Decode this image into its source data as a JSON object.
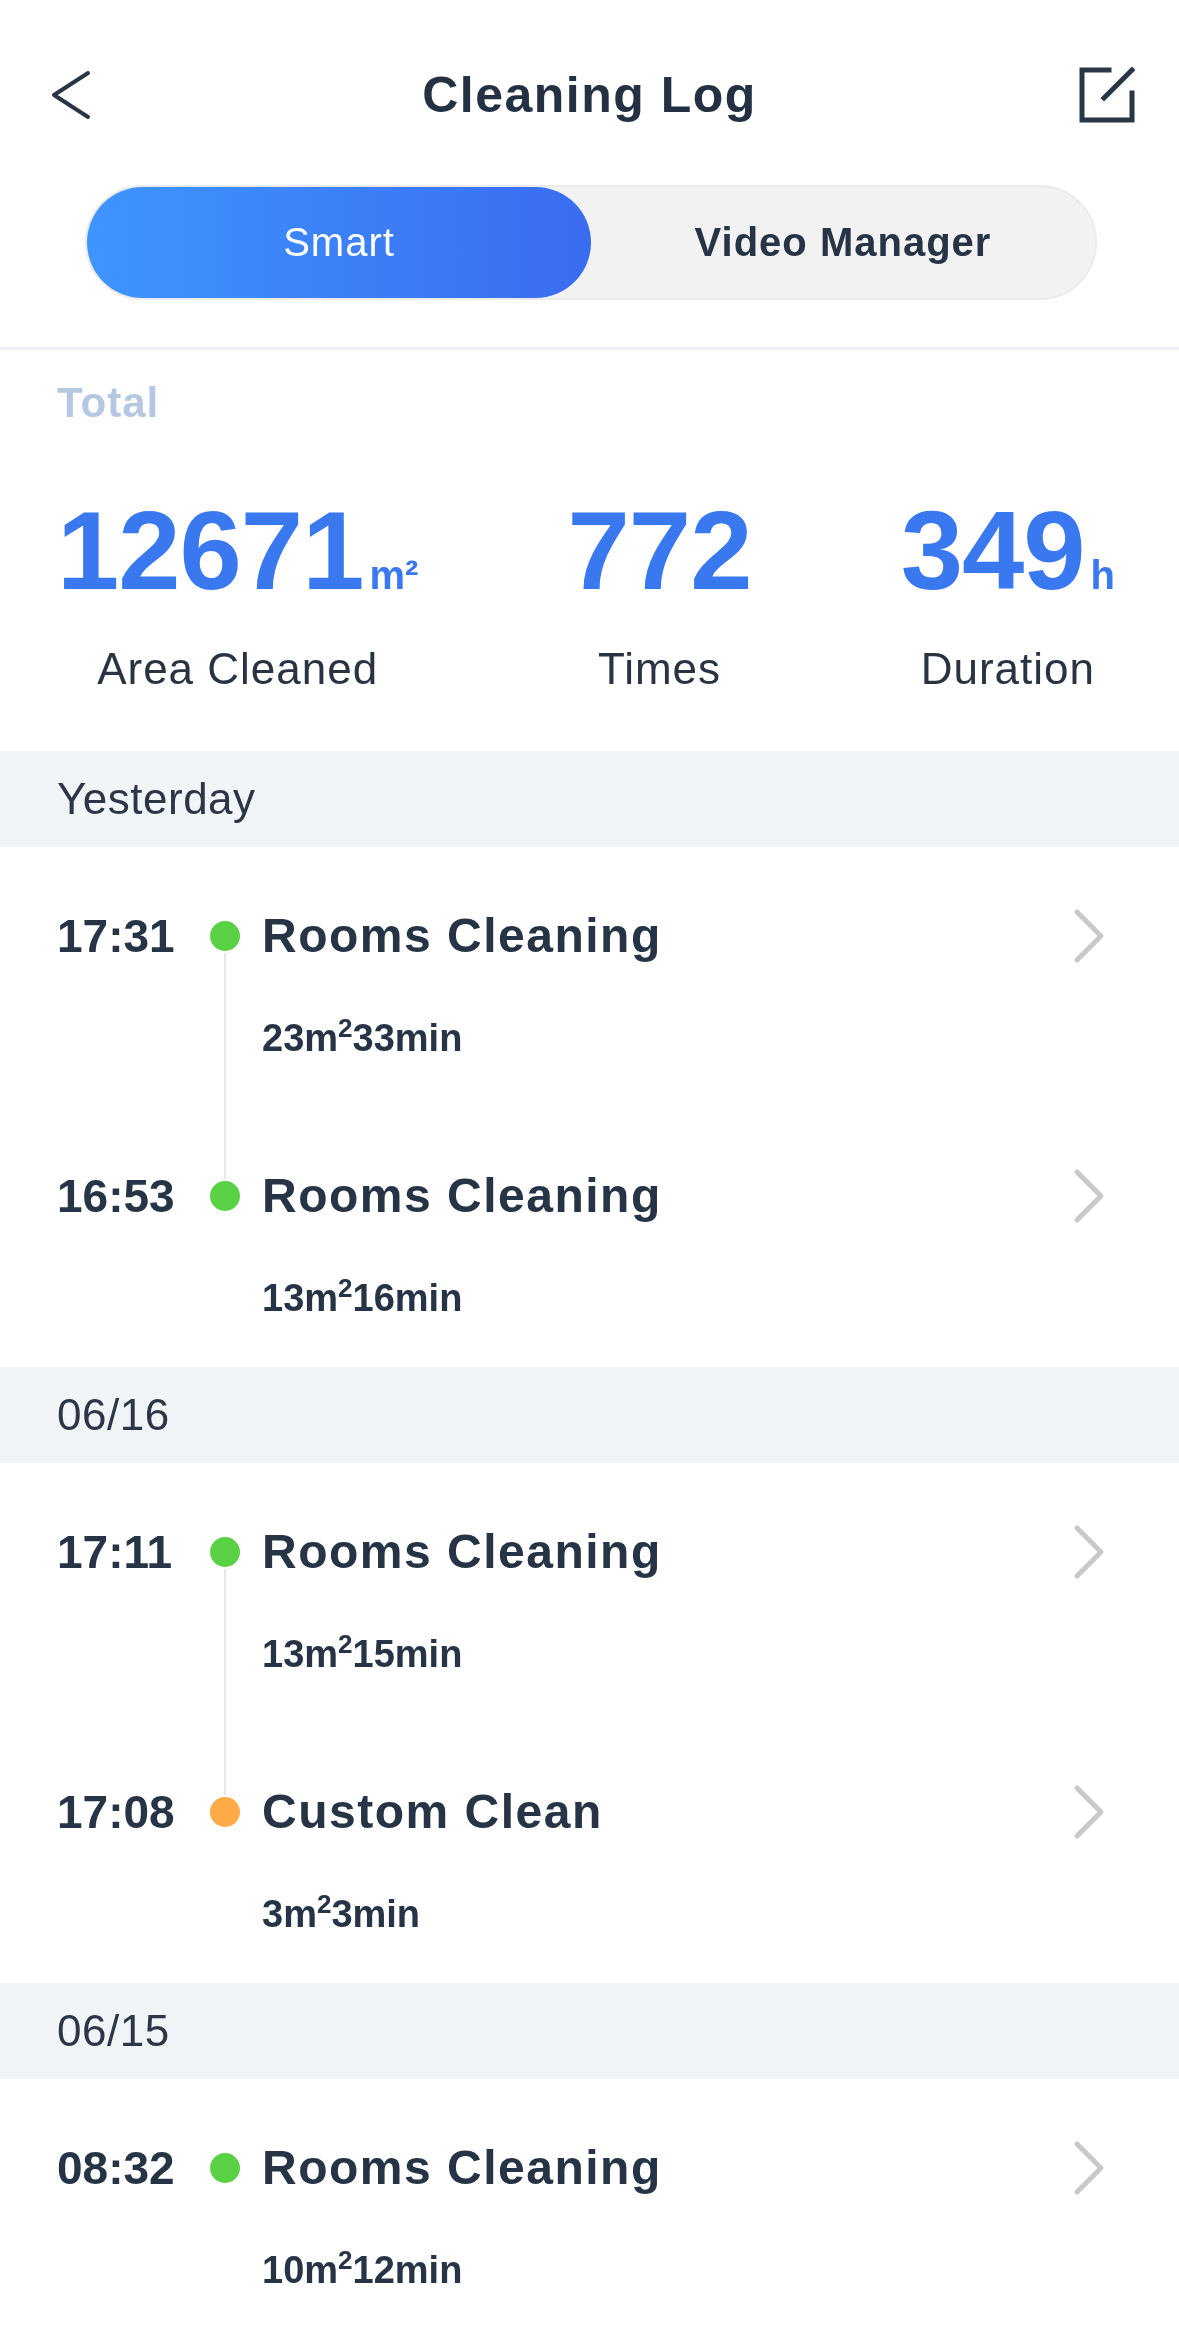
{
  "header": {
    "title": "Cleaning Log"
  },
  "tabs": [
    {
      "label": "Smart",
      "selected": true
    },
    {
      "label": "Video Manager",
      "selected": false
    }
  ],
  "total": {
    "label": "Total",
    "stats": [
      {
        "value": "12671",
        "unit": "m²",
        "label": "Area Cleaned"
      },
      {
        "value": "772",
        "label": "Times"
      },
      {
        "value": "349",
        "unit": "h",
        "label": "Duration"
      }
    ]
  },
  "sections": [
    {
      "date": "Yesterday",
      "entries": [
        {
          "time": "17:31",
          "color": "#5ad044",
          "title": "Rooms Cleaning",
          "summary": "23m$^{2}$33min"
        },
        {
          "time": "16:53",
          "color": "#5ad044",
          "title": "Rooms Cleaning",
          "summary": "13m$^{2}$16min"
        }
      ]
    },
    {
      "date": "06/16",
      "entries": [
        {
          "time": "17:11",
          "color": "#5ad044",
          "title": "Rooms Cleaning",
          "summary": "13m$^{2}$15min"
        },
        {
          "time": "17:08",
          "color": "#ffab48",
          "title": "Custom Clean",
          "summary": "3m$^{2}$3min"
        }
      ]
    },
    {
      "date": "06/15",
      "entries": [
        {
          "time": "08:32",
          "color": "#5ad044",
          "title": "Rooms Cleaning",
          "summary": "10m$^{2}$12min"
        }
      ]
    }
  ]
}
